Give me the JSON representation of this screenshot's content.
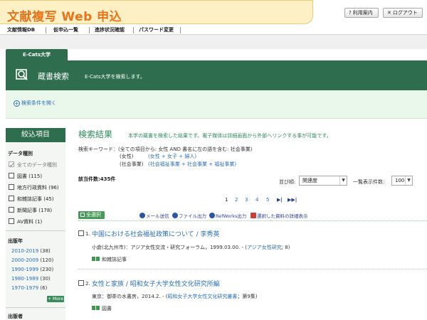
{
  "header": {
    "title": "文献複写 Web 申込",
    "help_label": "利用案内",
    "logout_label": "ログアウト",
    "help_icon": "question-icon",
    "logout_icon": "close-icon"
  },
  "nav": {
    "items": [
      "文献情報DB",
      "仮申込一覧",
      "進捗状況確認",
      "パスワード変更"
    ]
  },
  "library": {
    "tab_label": "E-Cats大学",
    "panel_title": "蔵書検索",
    "panel_desc": "E-Cats大学を検索します。",
    "open_conditions": "検索条件を開く"
  },
  "sidebar": {
    "title": "絞込項目",
    "data_type": {
      "heading": "データ種別",
      "items": [
        {
          "label": "全てのデータ種別",
          "count": "",
          "checked": true
        },
        {
          "label": "図書",
          "count": "(115)",
          "checked": false
        },
        {
          "label": "地方行政資料",
          "count": "(96)",
          "checked": false
        },
        {
          "label": "和雑誌記事",
          "count": "(45)",
          "checked": false
        },
        {
          "label": "新聞記事",
          "count": "(178)",
          "checked": false
        },
        {
          "label": "AV資料",
          "count": "(1)",
          "checked": false
        }
      ]
    },
    "year": {
      "heading": "出版年",
      "items": [
        {
          "label": "2010-2019",
          "count": "(38)"
        },
        {
          "label": "2000-2009",
          "count": "(120)"
        },
        {
          "label": "1990-1999",
          "count": "(230)"
        },
        {
          "label": "1980-1989",
          "count": "(30)"
        },
        {
          "label": "1970-1979",
          "count": "(6)"
        }
      ],
      "more_label": "+ More"
    },
    "publisher_heading": "出版者"
  },
  "results": {
    "title": "検索結果",
    "subtitle": "本学の蔵書を検索した結果です。電子媒体は詳細画面から外部へリンクする事が可能です。",
    "keyword_label": "検索キーワード：",
    "keyword_line1": "(全ての項目から: 女性 AND 書名に左の語を含む: 社会事業)",
    "keyword_line2_a": "(女性)",
    "keyword_line2_b": "(女性 + 女子 + 婦人)",
    "keyword_line3_a": "(社会事業)",
    "keyword_line3_b": "(社会福祉事業 + 社会事業 + 福祉事業)",
    "count_text": "該当件数:435件",
    "sort_label": "並び順:",
    "sort_value": "関連度",
    "per_page_label": "一覧表示件数:",
    "per_page_value": "100",
    "pages": [
      "1",
      "2",
      "3",
      "4",
      "5"
    ],
    "next_icon": "next-page-icon",
    "last_icon": "last-page-icon",
    "actions": {
      "select_all": "全選択",
      "mail": "メール送信",
      "file": "ファイル出力",
      "refworks": "RefWorks出力",
      "detail": "選択した資料の詳細表示"
    },
    "records": [
      {
        "no": "1.",
        "title": "中国における社会福祉政策について / 李秀英",
        "meta_pre": "小倉(北九州市)：アジア女性交流・研究フォーラム，1999.03.00. - (",
        "meta_link": "アジア女性研究",
        "meta_post": "; 8)",
        "type": "和雑誌記事"
      },
      {
        "no": "2.",
        "title": "女性と家族 / 昭和女子大学女性文化研究所編",
        "meta_pre": "東京：御茶の水書房，2014.2. - (",
        "meta_link": "昭和女子大学女性文化研究叢書",
        "meta_post": "；第9集)",
        "type": "図書"
      }
    ]
  },
  "colors": {
    "accent_green": "#2e6e4e",
    "brand_orange": "#e8731a",
    "link_blue": "#2a6db5"
  }
}
